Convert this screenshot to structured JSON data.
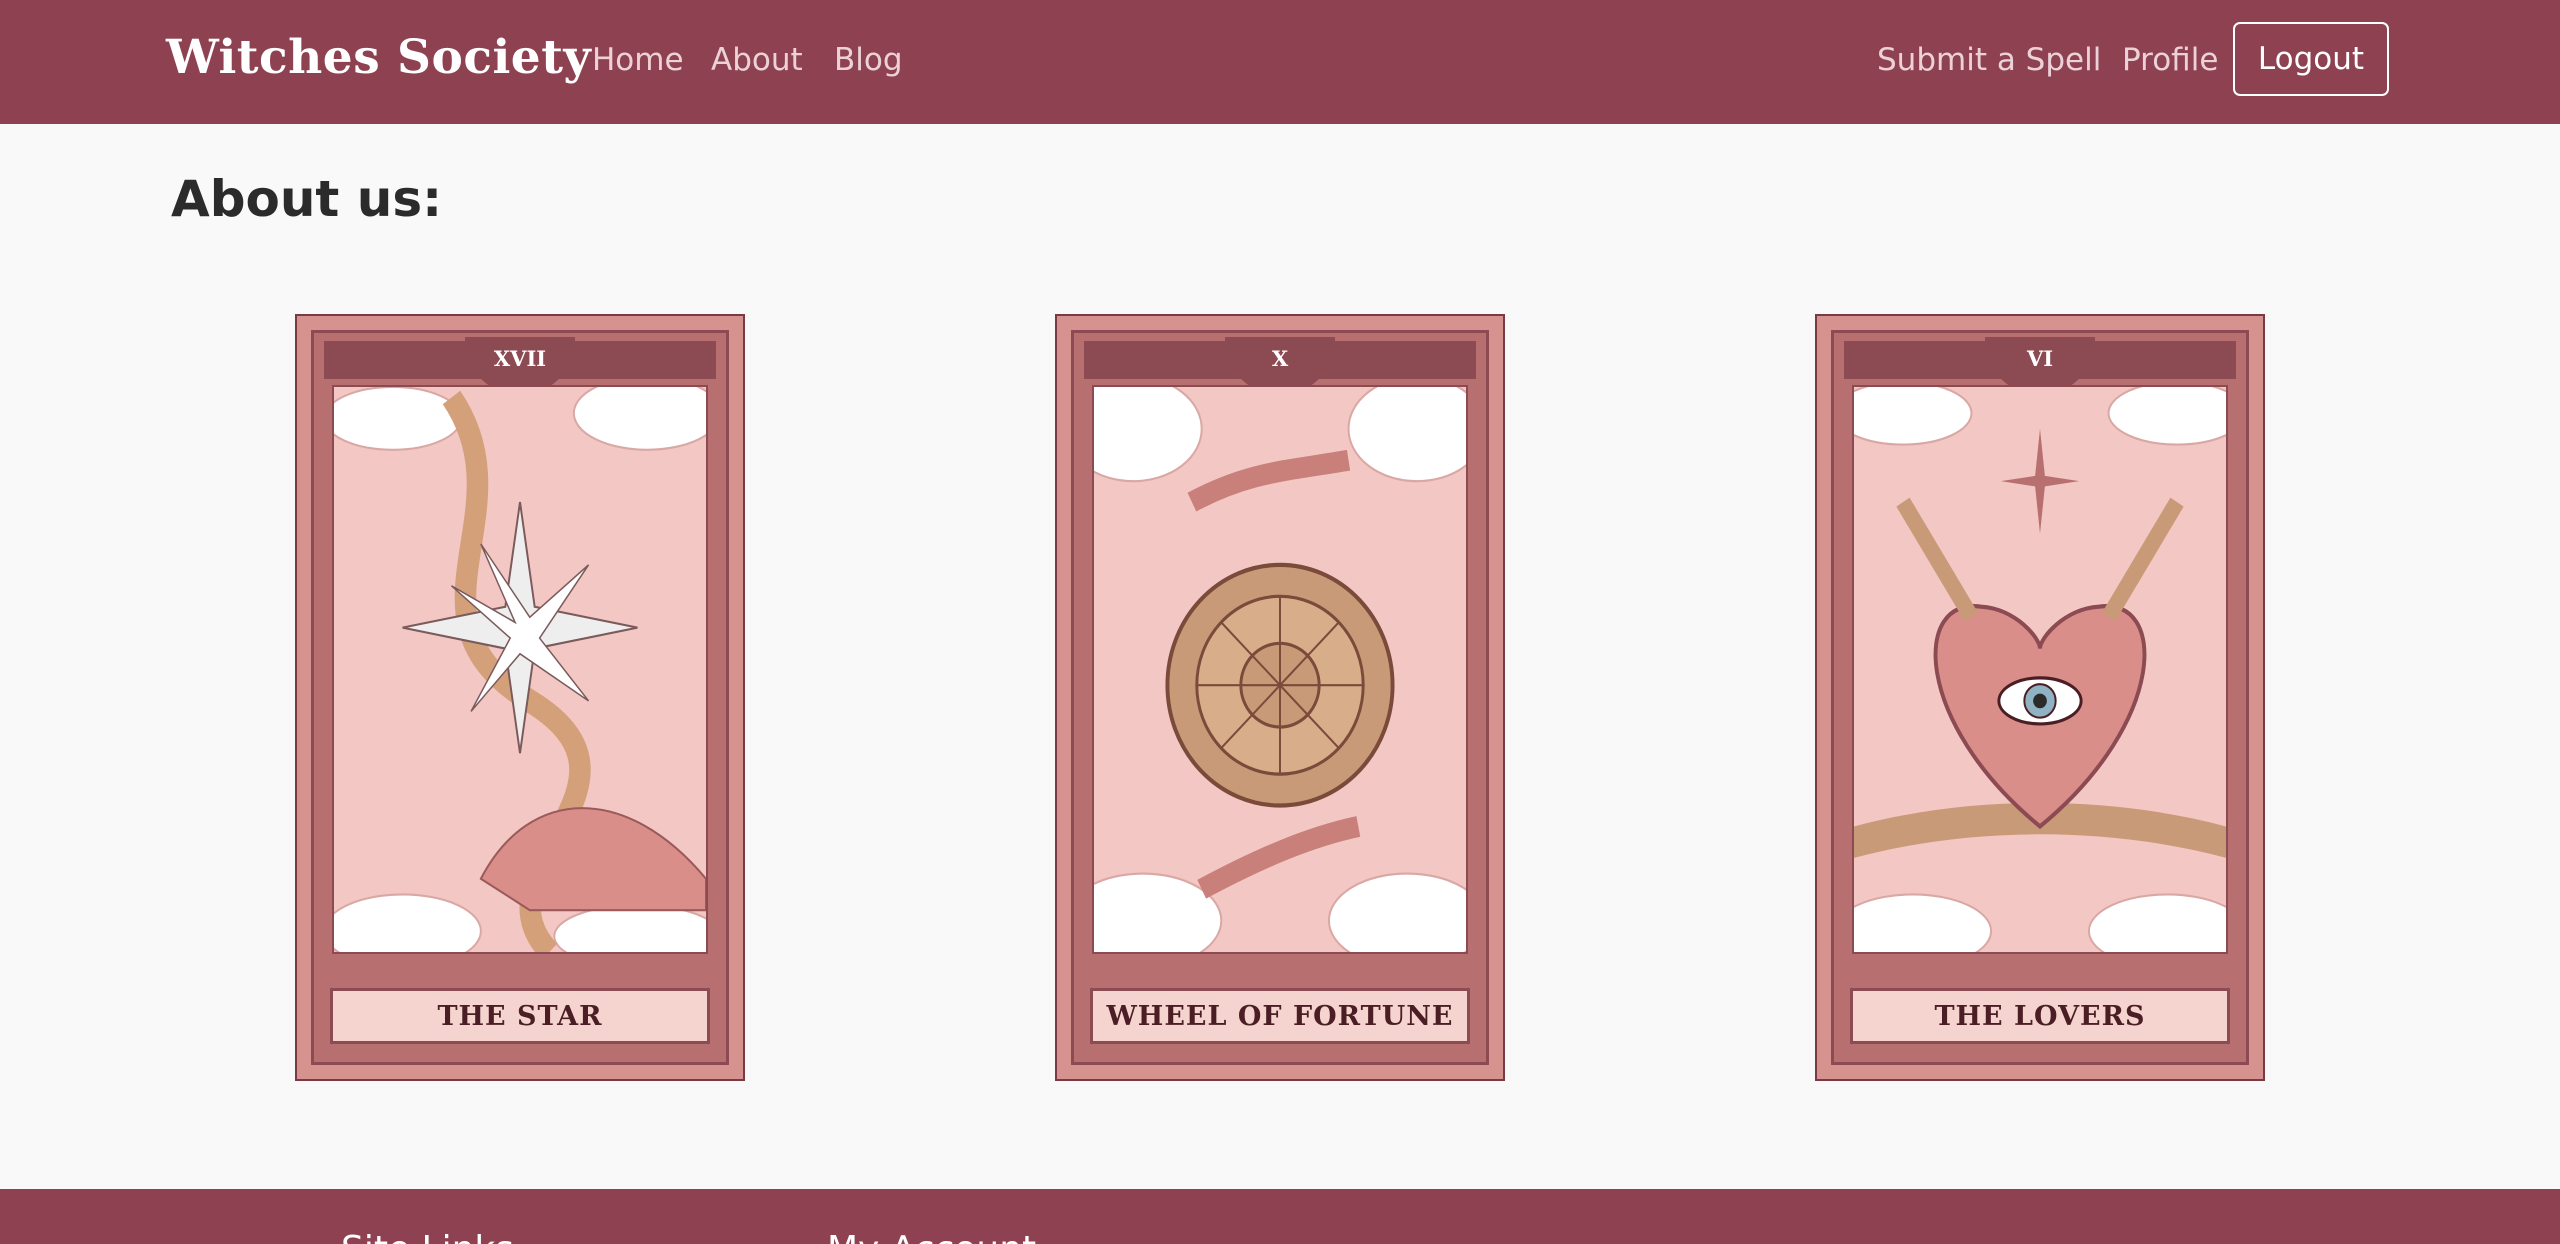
{
  "navbar": {
    "brand": "Witches Society",
    "links": [
      "Home",
      "About",
      "Blog"
    ],
    "right_links": [
      "Submit a Spell",
      "Profile"
    ],
    "logout_label": "Logout",
    "background": "#8e4251"
  },
  "main": {
    "title": "About us:",
    "cards": [
      {
        "numeral": "XVII",
        "name": "THE STAR",
        "icon": "star-tarot-card"
      },
      {
        "numeral": "X",
        "name": "WHEEL OF FORTUNE",
        "icon": "wheel-of-fortune-tarot-card"
      },
      {
        "numeral": "VI",
        "name": "THE LOVERS",
        "icon": "lovers-tarot-card"
      }
    ]
  },
  "footer": {
    "site_links_heading": "Site Links",
    "account_heading": "My Account"
  },
  "colors": {
    "accent": "#8e4251",
    "card_frame": "#d6928f",
    "card_art": "#f3c7c3",
    "page_bg": "#f9f9f9"
  }
}
